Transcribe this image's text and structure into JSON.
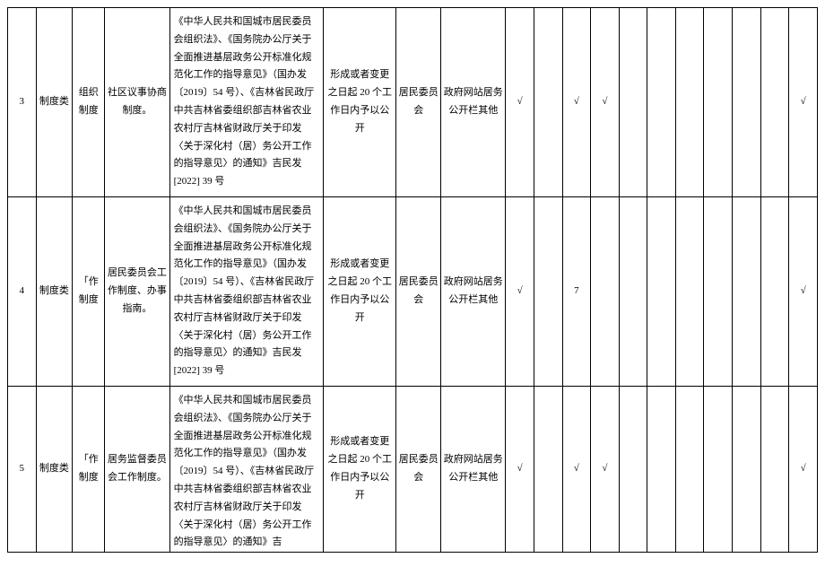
{
  "rows": [
    {
      "idx": "3",
      "cat1": "制度类",
      "cat2": "组织制度",
      "content": "社区议事协商制度。",
      "basis": "《中华人民共和国城市居民委员会组织法》、《国务院办公厅关于全面推进基层政务公开标准化规范化工作的指导意见》（国办发〔2019〕54 号）、《吉林省民政厅中共吉林省委组织部吉林省农业农村厅吉林省财政厅关于印发〈关于深化村（居）务公开工作的指导意见〉的通知》吉民发 [2022] 39 号",
      "time": "形成或者变更之日起 20 个工作日内予以公开",
      "subject": "居民委员会",
      "channel": "政府网站居务公开栏其他",
      "marks": [
        "√",
        "",
        "√",
        "√",
        "",
        "",
        "",
        "",
        "",
        "",
        "√"
      ]
    },
    {
      "idx": "4",
      "cat1": "制度类",
      "cat2": "「作制度",
      "content": "居民委员会工作制度、办事指南。",
      "basis": "《中华人民共和国城市居民委员会组织法》、《国务院办公厅关于全面推进基层政务公开标准化规范化工作的指导意见》（国办发〔2019〕54 号）、《吉林省民政厅中共吉林省委组织部吉林省农业农村厅吉林省财政厅关于印发〈关于深化村（居）务公开工作的指导意见〉的通知》吉民发 [2022] 39 号",
      "time": "形成或者变更之日起 20 个工作日内予以公开",
      "subject": "居民委员会",
      "channel": "政府网站居务公开栏其他",
      "marks": [
        "√",
        "",
        "7",
        "",
        "",
        "",
        "",
        "",
        "",
        "",
        "√"
      ]
    },
    {
      "idx": "5",
      "cat1": "制度类",
      "cat2": "「作制度",
      "content": "居务监督委员会工作制度。",
      "basis": "《中华人民共和国城市居民委员会组织法》、《国务院办公厅关于全面推进基层政务公开标准化规范化工作的指导意见》（国办发〔2019〕54 号）、《吉林省民政厅中共吉林省委组织部吉林省农业农村厅吉林省财政厅关于印发〈关于深化村（居）务公开工作的指导意见〉的通知》吉",
      "time": "形成或者变更之日起 20 个工作日内予以公开",
      "subject": "居民委员会",
      "channel": "政府网站居务公开栏其他",
      "marks": [
        "√",
        "",
        "√",
        "√",
        "",
        "",
        "",
        "",
        "",
        "",
        "√"
      ]
    }
  ]
}
